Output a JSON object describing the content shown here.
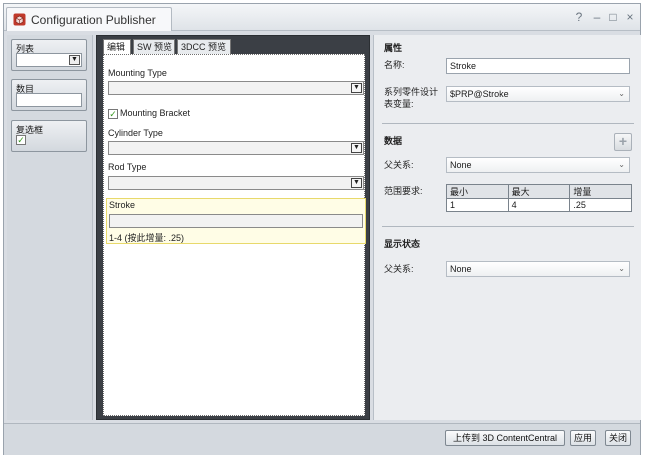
{
  "window": {
    "title": "Configuration Publisher",
    "controls": {
      "help": "?",
      "minimize": "–",
      "maximize": "□",
      "close": "×"
    }
  },
  "toolbox": {
    "items": [
      {
        "label": "列表",
        "kind": "list"
      },
      {
        "label": "数目",
        "kind": "number"
      },
      {
        "label": "复选框",
        "kind": "checkbox"
      }
    ]
  },
  "designer": {
    "tabs": [
      {
        "label": "编辑",
        "active": true
      },
      {
        "label": "SW 预览",
        "active": false
      },
      {
        "label": "3DCC 预览",
        "active": false
      }
    ],
    "fields": {
      "mounting_type": {
        "label": "Mounting Type"
      },
      "mounting_bracket": {
        "label": "Mounting Bracket",
        "checked": true
      },
      "cylinder_type": {
        "label": "Cylinder Type"
      },
      "rod_type": {
        "label": "Rod Type"
      },
      "stroke": {
        "label": "Stroke",
        "value": "",
        "hint": "1-4 (按此增量: .25)"
      }
    }
  },
  "properties": {
    "section_attributes": "属性",
    "name_label": "名称:",
    "name_value": "Stroke",
    "variable_label_1": "系列零件设计",
    "variable_label_2": "表变量:",
    "variable_value": "$PRP@Stroke",
    "section_data": "数据",
    "parent_label": "父关系:",
    "parent_value": "None",
    "range_label": "范围要求:",
    "range": {
      "headers": [
        "最小",
        "最大",
        "增量"
      ],
      "values": [
        "1",
        "4",
        ".25"
      ]
    },
    "section_display": "显示状态",
    "display_parent_label": "父关系:",
    "display_parent_value": "None"
  },
  "footer": {
    "upload_label": "上传到 3D ContentCentral",
    "apply_label": "应用",
    "close_label": "关闭"
  }
}
